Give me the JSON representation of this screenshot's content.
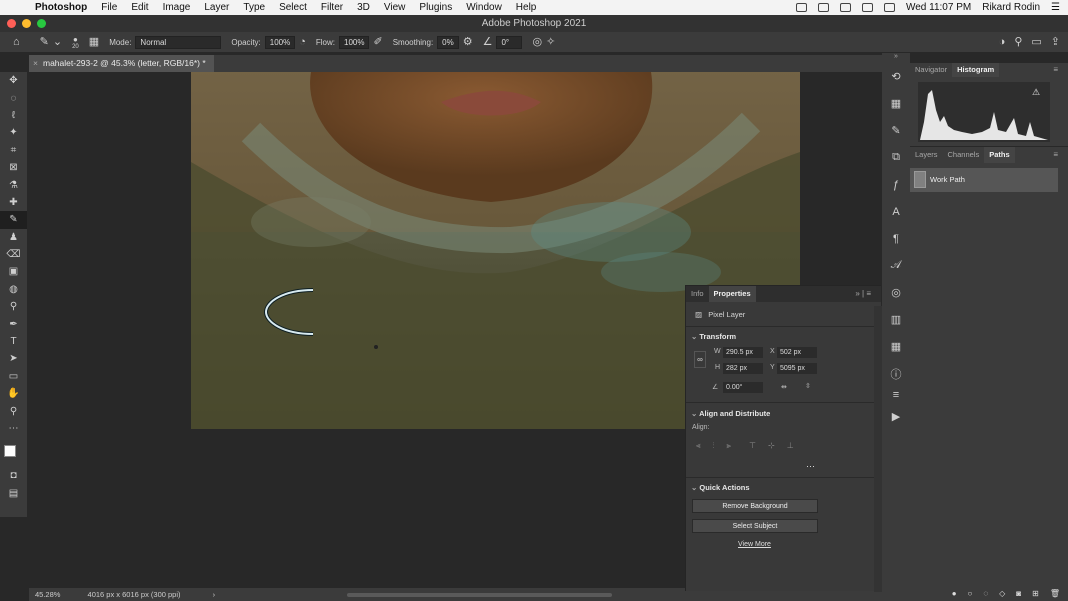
{
  "menubar": {
    "app_name": "Photoshop",
    "menus": [
      "File",
      "Edit",
      "Image",
      "Layer",
      "Type",
      "Select",
      "Filter",
      "3D",
      "View",
      "Plugins",
      "Window",
      "Help"
    ],
    "clock": "Wed 11:07 PM",
    "user": "Rikard Rodin"
  },
  "window": {
    "title": "Adobe Photoshop 2021"
  },
  "options": {
    "brush_size": "20",
    "mode_label": "Mode:",
    "mode_value": "Normal",
    "opacity_label": "Opacity:",
    "opacity_value": "100%",
    "flow_label": "Flow:",
    "flow_value": "100%",
    "smoothing_label": "Smoothing:",
    "smoothing_value": "0%",
    "angle_value": "0°"
  },
  "document": {
    "tab_title": "mahalet-293-2 @ 45.3% (letter, RGB/16*) *"
  },
  "status": {
    "zoom": "45.28%",
    "info": "4016 px x 6016 px (300 ppi)"
  },
  "navigator": {
    "tabs": [
      "Navigator",
      "Histogram"
    ],
    "active": "Histogram"
  },
  "layers": {
    "tabs": [
      "Layers",
      "Channels",
      "Paths"
    ],
    "active": "Paths",
    "path_name": "Work Path"
  },
  "properties": {
    "tabs": [
      "Info",
      "Properties"
    ],
    "active": "Properties",
    "layer_type": "Pixel Layer",
    "transform": {
      "title": "Transform",
      "w_label": "W",
      "w": "290.5 px",
      "x_label": "X",
      "x": "502 px",
      "h_label": "H",
      "h": "282 px",
      "y_label": "Y",
      "y": "5095 px",
      "angle": "0.00°"
    },
    "align": {
      "title": "Align and Distribute",
      "label": "Align:"
    },
    "quick_actions": {
      "title": "Quick Actions",
      "remove_bg": "Remove Background",
      "select_subject": "Select Subject",
      "view_more": "View More"
    }
  },
  "colors": {
    "accent": "#3b3b3b",
    "canvas_bg": "#282828"
  }
}
